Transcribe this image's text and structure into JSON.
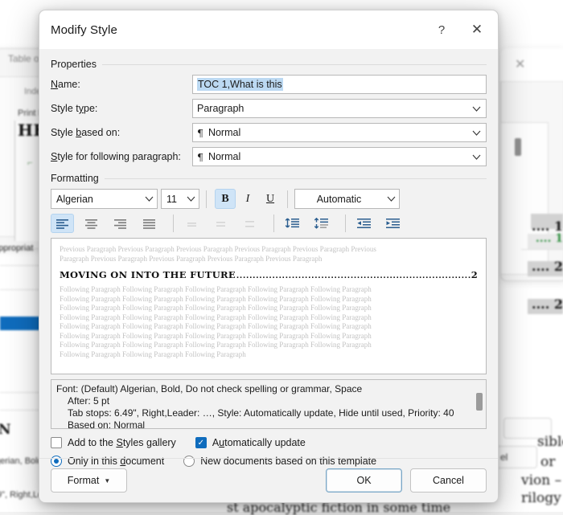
{
  "dialog": {
    "title": "Modify Style",
    "help_label": "?",
    "close_label": "✕"
  },
  "properties": {
    "section_label": "Properties",
    "name_label_pre": "N",
    "name_label_key": "a",
    "name_label_post": "me:",
    "name_label": "Name:",
    "name_value": "TOC 1,What is this",
    "style_type_label": "Style type:",
    "style_type_value": "Paragraph",
    "style_based_on_label": "Style based on:",
    "style_based_on_value": "Normal",
    "style_following_label": "Style for following paragraph:",
    "style_following_value": "Normal",
    "pilcrow": "¶"
  },
  "formatting": {
    "section_label": "Formatting",
    "font_name": "Algerian",
    "font_size": "11",
    "font_color": "Automatic",
    "bold_label": "B",
    "italic_label": "I",
    "underline_label": "U",
    "bold_active": true,
    "italic_active": false,
    "underline_active": false,
    "align_active": "left"
  },
  "preview": {
    "previous_lines": [
      "Previous Paragraph Previous Paragraph Previous Paragraph Previous Paragraph Previous Paragraph Previous",
      "Paragraph Previous Paragraph Previous Paragraph Previous Paragraph Previous Paragraph"
    ],
    "heading_text": "MOVING ON INTO THE FUTURE",
    "heading_leader": "......................................................................................................",
    "heading_page": "2",
    "following_lines": [
      "Following Paragraph Following Paragraph Following Paragraph Following Paragraph Following Paragraph",
      "Following Paragraph Following Paragraph Following Paragraph Following Paragraph Following Paragraph",
      "Following Paragraph Following Paragraph Following Paragraph Following Paragraph Following Paragraph",
      "Following Paragraph Following Paragraph Following Paragraph Following Paragraph Following Paragraph",
      "Following Paragraph Following Paragraph Following Paragraph Following Paragraph Following Paragraph",
      "Following Paragraph Following Paragraph Following Paragraph Following Paragraph Following Paragraph",
      "Following Paragraph Following Paragraph Following Paragraph Following Paragraph Following Paragraph",
      "Following Paragraph Following Paragraph Following Paragraph"
    ]
  },
  "description": {
    "line1": "Font: (Default) Algerian, Bold, Do not check spelling or grammar, Space",
    "line2": "After:  5 pt",
    "line3": "Tab stops:  6.49\", Right,Leader: …, Style: Automatically update, Hide until used, Priority: 40",
    "line4": "Based on: Normal"
  },
  "options": {
    "add_gallery_label": "Add to the Styles gallery",
    "add_gallery_checked": false,
    "auto_update_label": "Automatically update",
    "auto_update_checked": true,
    "check_glyph": "✓",
    "only_document_label": "Only in this document",
    "new_documents_label": "New documents based on this template",
    "scope_selected": "only_document"
  },
  "footer": {
    "format_label": "Format",
    "format_caret": "▼",
    "ok_label": "OK",
    "cancel_label": "Cancel"
  },
  "background": {
    "toc_dialog_title": "Table o",
    "index_tab": "Inde",
    "print_preview_label": "Print P",
    "doc_heading": "HE",
    "styles_item": "ppropriat",
    "style_name_fragment": "N",
    "desc_fragment_1": "gerian, Bold",
    "desc_fragment_2": "9\", Right,Le",
    "cancel_fragment": "el",
    "body_text_1": "sible",
    "body_text_2": "or",
    "body_text_3": "vion – is",
    "body_text_4": "rilogy is",
    "body_text_5": "st apocalyptic fiction in some time",
    "toc_entry_1": ".... 1",
    "toc_entry_2": ".... 1",
    "toc_entry_3": ".... 2",
    "toc_entry_4": ".... 2"
  },
  "colors": {
    "accent": "#0f6cbd",
    "active_tool": "#cfe4f7",
    "selection": "#bcd9f2",
    "dialog_bg": "#f2f2f2"
  }
}
